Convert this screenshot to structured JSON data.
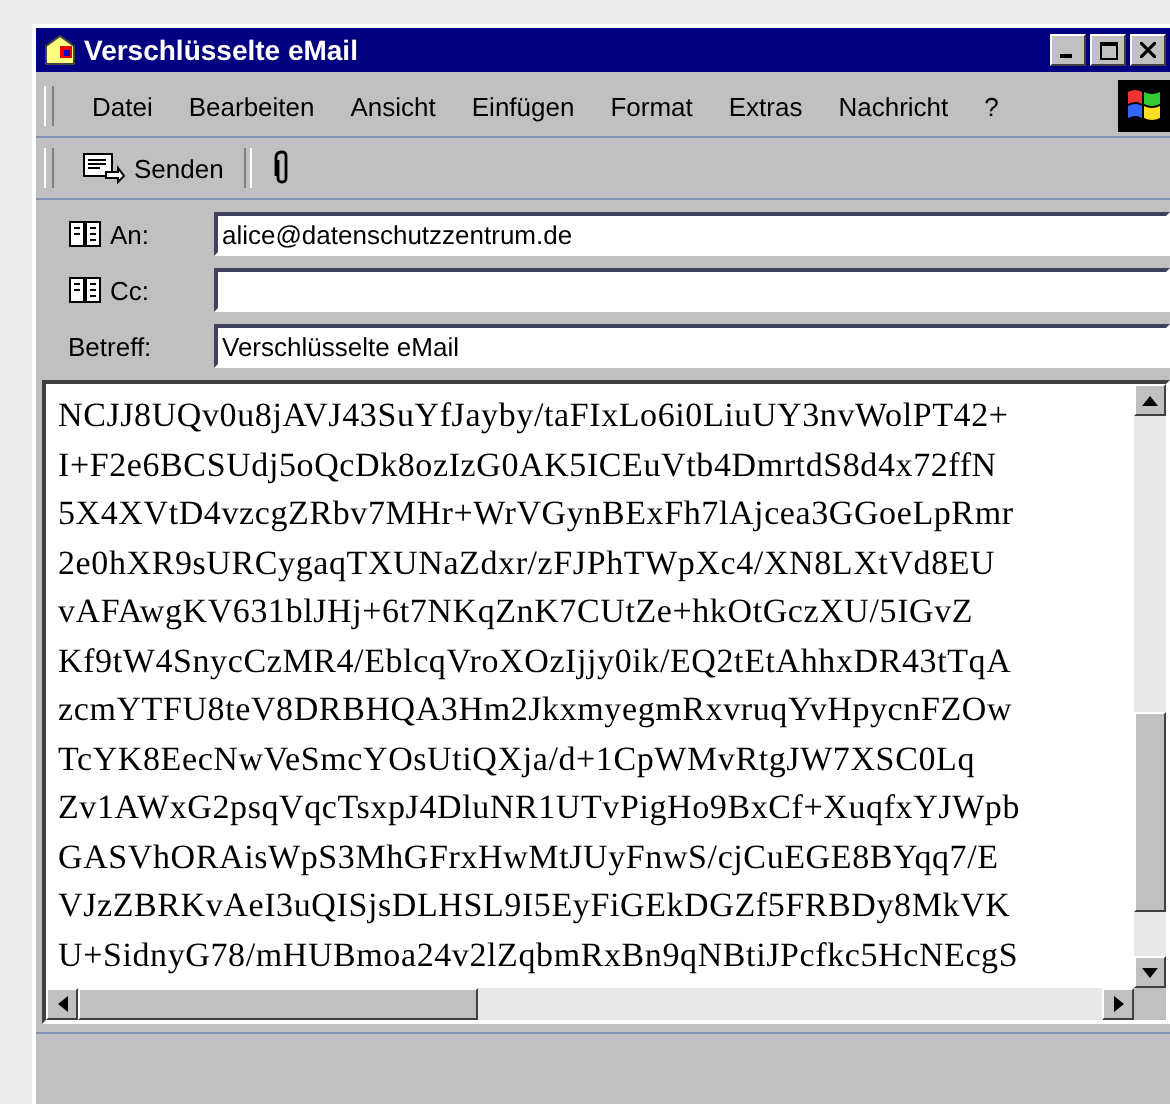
{
  "window": {
    "title": "Verschlüsselte eMail"
  },
  "menu": [
    {
      "label": "Datei"
    },
    {
      "label": "Bearbeiten"
    },
    {
      "label": "Ansicht"
    },
    {
      "label": "Einfügen"
    },
    {
      "label": "Format"
    },
    {
      "label": "Extras"
    },
    {
      "label": "Nachricht"
    },
    {
      "label": "?"
    }
  ],
  "toolbar": [
    {
      "kind": "send",
      "label": "Senden"
    },
    {
      "kind": "attach"
    }
  ],
  "fields": [
    {
      "label": "An:",
      "address_book": true,
      "value": "alice@datenschutzzentrum.de"
    },
    {
      "label": "Cc:",
      "address_book": true
    },
    {
      "label": "Betreff:",
      "address_book": false,
      "value": "Verschlüsselte eMail"
    }
  ],
  "body_lines": [
    "NCJJ8UQv0u8jAVJ43SuYfJayby/taFIxLo6i0LiuUY3nvWolPT42+",
    "I+F2e6BCSUdj5oQcDk8ozIzG0AK5ICEuVtb4DmrtdS8d4x72ffN",
    "5X4XVtD4vzcgZRbv7MHr+WrVGynBExFh7lAjcea3GGoeLpRmr",
    "2e0hXR9sURCygaqTXUNaZdxr/zFJPhTWpXc4/XN8LXtVd8EU",
    "vAFAwgKV631blJHj+6t7NKqZnK7CUtZe+hkOtGczXU/5IGvZ",
    "Kf9tW4SnycCzMR4/EblcqVroXOzIjjy0ik/EQ2tEtAhhxDR43tTqA",
    "zcmYTFU8teV8DRBHQA3Hm2JkxmyegmRxvruqYvHpycnFZOw",
    "TcYK8EecNwVeSmcYOsUtiQXja/d+1CpWMvRtgJW7XSC0Lq",
    "Zv1AWxG2psqVqcTsxpJ4DluNR1UTvPigHo9BxCf+XuqfxYJWpb",
    "GASVhORAisWpS3MhGFrxHwMtJUyFnwS/cjCuEGE8BYqq7/E",
    "VJzZBRKvAeI3uQISjsDLHSL9I5EyFiGEkDGZf5FRBDy8MkVK",
    "U+SidnyG78/mHUBmoa24v2lZqbmRxBn9qNBtiJPcfkc5HcNEcgS"
  ]
}
